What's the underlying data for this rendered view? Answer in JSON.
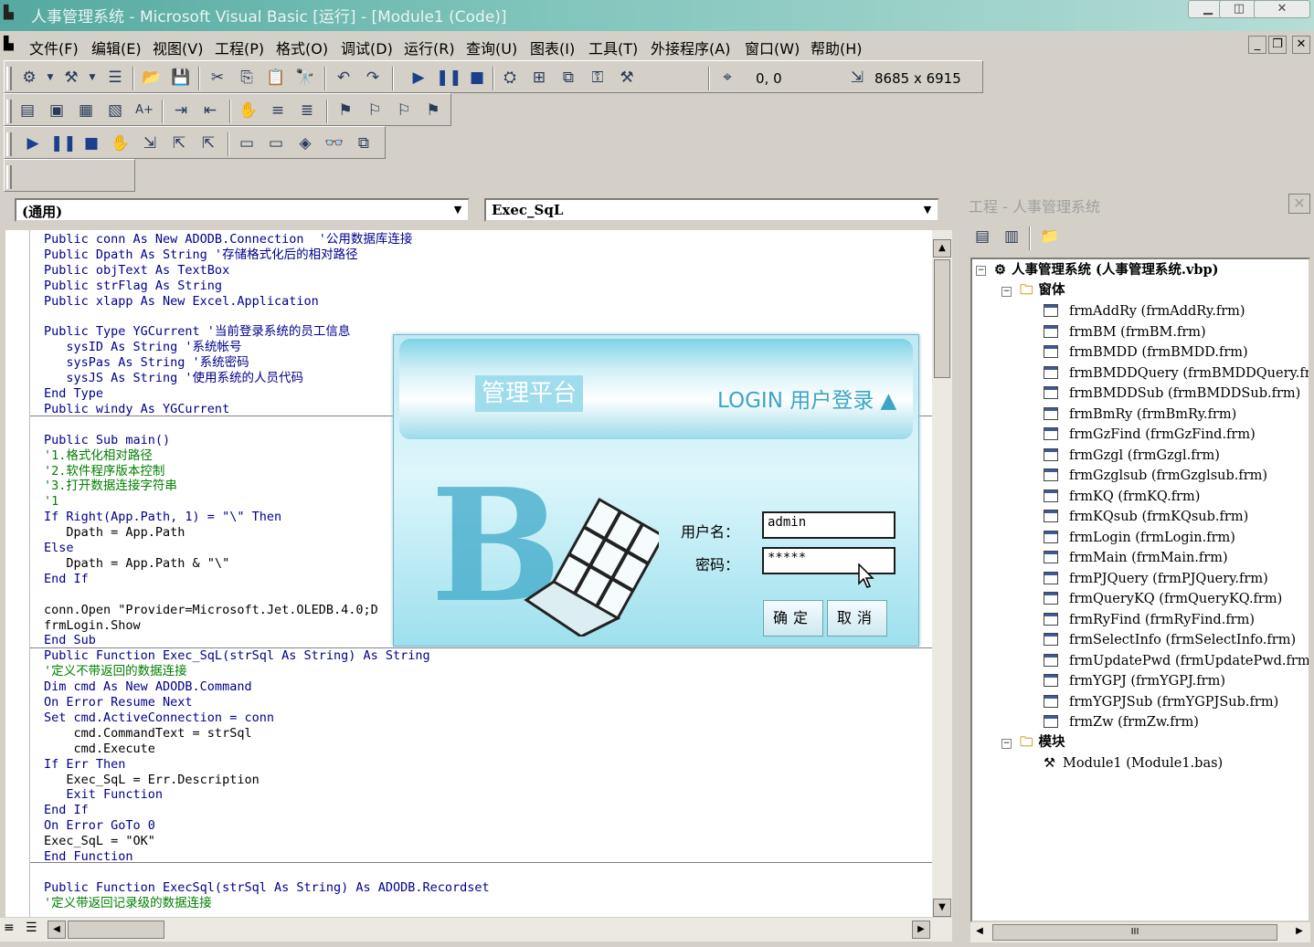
{
  "window": {
    "title": "人事管理系统 - Microsoft Visual Basic [运行] - [Module1 (Code)]"
  },
  "menu": [
    "文件(F)",
    "编辑(E)",
    "视图(V)",
    "工程(P)",
    "格式(O)",
    "调试(D)",
    "运行(R)",
    "查询(U)",
    "图表(I)",
    "工具(T)",
    "外接程序(A)",
    "窗口(W)",
    "帮助(H)"
  ],
  "toolbar": {
    "position": "0, 0",
    "size": "8685 x 6915"
  },
  "editor": {
    "object_combo": "(通用)",
    "proc_combo": "Exec_SqL",
    "lines": [
      {
        "t": "Public conn As New ADODB.Connection  '公用数据库连接",
        "c": "kw"
      },
      {
        "t": "Public Dpath As String '存储格式化后的相对路径",
        "c": "kw"
      },
      {
        "t": "Public objText As TextBox",
        "c": "kw"
      },
      {
        "t": "Public strFlag As String",
        "c": "kw"
      },
      {
        "t": "Public xlapp As New Excel.Application",
        "c": "kw"
      },
      {
        "t": "",
        "c": ""
      },
      {
        "t": "Public Type YGCurrent '当前登录系统的员工信息",
        "c": "kw"
      },
      {
        "t": "   sysID As String '系统帐号",
        "c": "kw"
      },
      {
        "t": "   sysPas As String '系统密码",
        "c": "kw"
      },
      {
        "t": "   sysJS As String '使用系统的人员代码",
        "c": "kw"
      },
      {
        "t": "End Type",
        "c": "kw"
      },
      {
        "t": "Public windy As YGCurrent",
        "c": "kw"
      },
      {
        "t": "",
        "c": ""
      },
      {
        "t": "Public Sub main()",
        "c": "kw"
      },
      {
        "t": "'1.格式化相对路径",
        "c": "cm"
      },
      {
        "t": "'2.软件程序版本控制",
        "c": "cm"
      },
      {
        "t": "'3.打开数据连接字符串",
        "c": "cm"
      },
      {
        "t": "'1",
        "c": "cm"
      },
      {
        "t": "If Right(App.Path, 1) = \"\\\" Then",
        "c": "kw"
      },
      {
        "t": "   Dpath = App.Path",
        "c": ""
      },
      {
        "t": "Else",
        "c": "kw"
      },
      {
        "t": "   Dpath = App.Path & \"\\\"",
        "c": ""
      },
      {
        "t": "End If",
        "c": "kw"
      },
      {
        "t": "",
        "c": ""
      },
      {
        "t": "conn.Open \"Provider=Microsoft.Jet.OLEDB.4.0;D",
        "c": ""
      },
      {
        "t": "frmLogin.Show",
        "c": ""
      },
      {
        "t": "End Sub",
        "c": "kw"
      },
      {
        "t": "Public Function Exec_SqL(strSql As String) As String",
        "c": "kw"
      },
      {
        "t": "'定义不带返回的数据连接",
        "c": "cm"
      },
      {
        "t": "Dim cmd As New ADODB.Command",
        "c": "kw"
      },
      {
        "t": "On Error Resume Next",
        "c": "kw"
      },
      {
        "t": "Set cmd.ActiveConnection = conn",
        "c": "kw"
      },
      {
        "t": "    cmd.CommandText = strSql",
        "c": ""
      },
      {
        "t": "    cmd.Execute",
        "c": ""
      },
      {
        "t": "If Err Then",
        "c": "kw"
      },
      {
        "t": "   Exec_SqL = Err.Description",
        "c": ""
      },
      {
        "t": "   Exit Function",
        "c": "kw"
      },
      {
        "t": "End If",
        "c": "kw"
      },
      {
        "t": "On Error GoTo 0",
        "c": "kw"
      },
      {
        "t": "Exec_SqL = \"OK\"",
        "c": ""
      },
      {
        "t": "End Function",
        "c": "kw"
      },
      {
        "t": "",
        "c": ""
      },
      {
        "t": "Public Function ExecSql(strSql As String) As ADODB.Recordset",
        "c": "kw"
      },
      {
        "t": "'定义带返回记录级的数据连接",
        "c": "cm"
      }
    ]
  },
  "login": {
    "platform": "管理平台",
    "title": "LOGIN 用户登录 ▲",
    "username_label": "用户名：",
    "username": "admin",
    "password_label": "密码：",
    "password": "*****",
    "ok": "确定",
    "cancel": "取消"
  },
  "project": {
    "title": "工程 - 人事管理系统",
    "root": "人事管理系统 (人事管理系统.vbp)",
    "forms_folder": "窗体",
    "forms": [
      "frmAddRy (frmAddRy.frm)",
      "frmBM (frmBM.frm)",
      "frmBMDD (frmBMDD.frm)",
      "frmBMDDQuery (frmBMDDQuery.frm)",
      "frmBMDDSub (frmBMDDSub.frm)",
      "frmBmRy (frmBmRy.frm)",
      "frmGzFind (frmGzFind.frm)",
      "frmGzgl (frmGzgl.frm)",
      "frmGzglsub (frmGzglsub.frm)",
      "frmKQ (frmKQ.frm)",
      "frmKQsub (frmKQsub.frm)",
      "frmLogin (frmLogin.frm)",
      "frmMain (frmMain.frm)",
      "frmPJQuery (frmPJQuery.frm)",
      "frmQueryKQ (frmQueryKQ.frm)",
      "frmRyFind (frmRyFind.frm)",
      "frmSelectInfo (frmSelectInfo.frm)",
      "frmUpdatePwd (frmUpdatePwd.frm)",
      "frmYGPJ (frmYGPJ.frm)",
      "frmYGPJSub (frmYGPJSub.frm)",
      "frmZw (frmZw.frm)"
    ],
    "modules_folder": "模块",
    "modules": [
      "Module1 (Module1.bas)"
    ]
  }
}
